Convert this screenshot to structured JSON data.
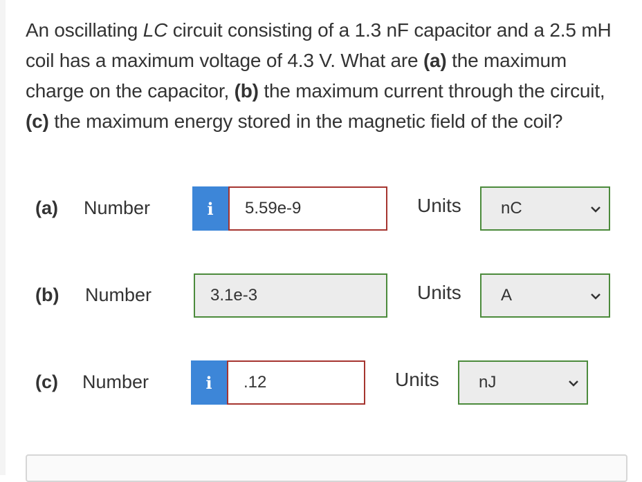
{
  "question": {
    "seg1": "An oscillating ",
    "seg2": "LC",
    "seg3": " circuit consisting of a 1.3 nF capacitor and a 2.5 mH coil has a maximum voltage of 4.3 V. What are ",
    "seg4": "(a)",
    "seg5": " the maximum charge on the capacitor, ",
    "seg6": "(b)",
    "seg7": " the maximum current through the circuit, ",
    "seg8": "(c)",
    "seg9": " the maximum energy stored in the magnetic field of the coil?"
  },
  "parts": [
    {
      "label": "(a)",
      "word": "Number",
      "value": "5.59e-9",
      "units_label": "Units",
      "unit": "nC",
      "info": "i"
    },
    {
      "label": "(b)",
      "word": "Number",
      "value": "3.1e-3",
      "units_label": "Units",
      "unit": "A"
    },
    {
      "label": "(c)",
      "word": "Number",
      "value": ".12",
      "units_label": "Units",
      "unit": "nJ",
      "info": "i"
    }
  ],
  "bottom_panel": {
    "peek_text": ""
  }
}
